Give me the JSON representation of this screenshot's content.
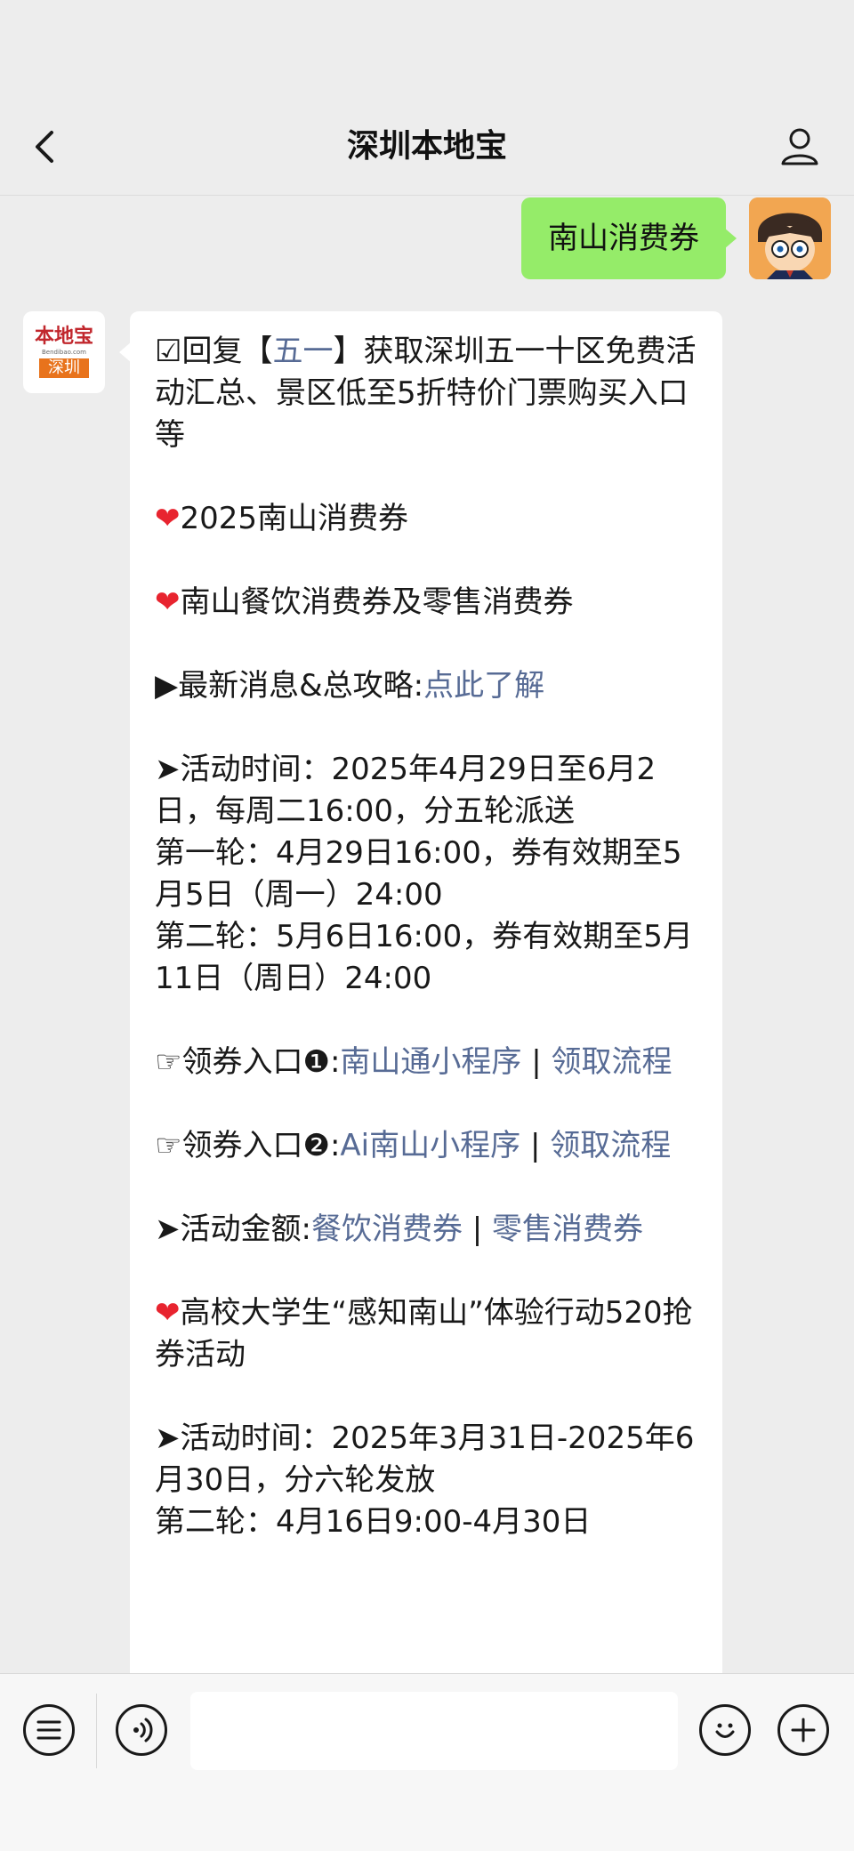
{
  "header": {
    "title": "深圳本地宝",
    "back_icon": "chevron-left-icon",
    "profile_icon": "person-icon"
  },
  "outgoing": {
    "text": "南山消费券",
    "bubble_color": "#95ec69"
  },
  "bot": {
    "logo_top": "本地宝",
    "logo_mid": "Bendibao.com",
    "logo_bottom": "深圳"
  },
  "message": {
    "p1_prefix": "☑回复【",
    "p1_link": "五一",
    "p1_suffix": "】获取深圳五一十区免费活动汇总、景区低至5折特价门票购买入口等",
    "h1": "2025南山消费券",
    "h2": "南山餐饮消费券及零售消费券",
    "news_prefix": "▶最新消息&总攻略:",
    "news_link": "点此了解",
    "time_lines": [
      "➤活动时间：2025年4月29日至6月2日，每周二16:00，分五轮派送",
      "第一轮：4月29日16:00，券有效期至5月5日（周一）24:00",
      "第二轮：5月6日16:00，券有效期至5月11日（周日）24:00"
    ],
    "entry1_prefix": "☞领券入口❶:",
    "entry1_link": "南山通小程序",
    "entry1_sep": " | ",
    "entry1_link2": "领取流程",
    "entry2_prefix": "☞领券入口❷:",
    "entry2_link": "Ai南山小程序",
    "entry2_sep": " | ",
    "entry2_link2": "领取流程",
    "amount_prefix": "➤活动金额:",
    "amount_link1": "餐饮消费券",
    "amount_sep": " | ",
    "amount_link2": "零售消费券",
    "h3": "高校大学生“感知南山”体验行动520抢券活动",
    "time2_lines": [
      "➤活动时间：2025年3月31日-2025年6月30日，分六轮发放",
      "第二轮：4月16日9:00-4月30日"
    ]
  },
  "input_bar": {
    "menu_icon": "menu-list-icon",
    "voice_icon": "voice-icon",
    "emoji_icon": "emoji-icon",
    "add_icon": "plus-icon"
  },
  "colors": {
    "link": "#576b95",
    "heart": "#e8242f",
    "background": "#ededed"
  }
}
